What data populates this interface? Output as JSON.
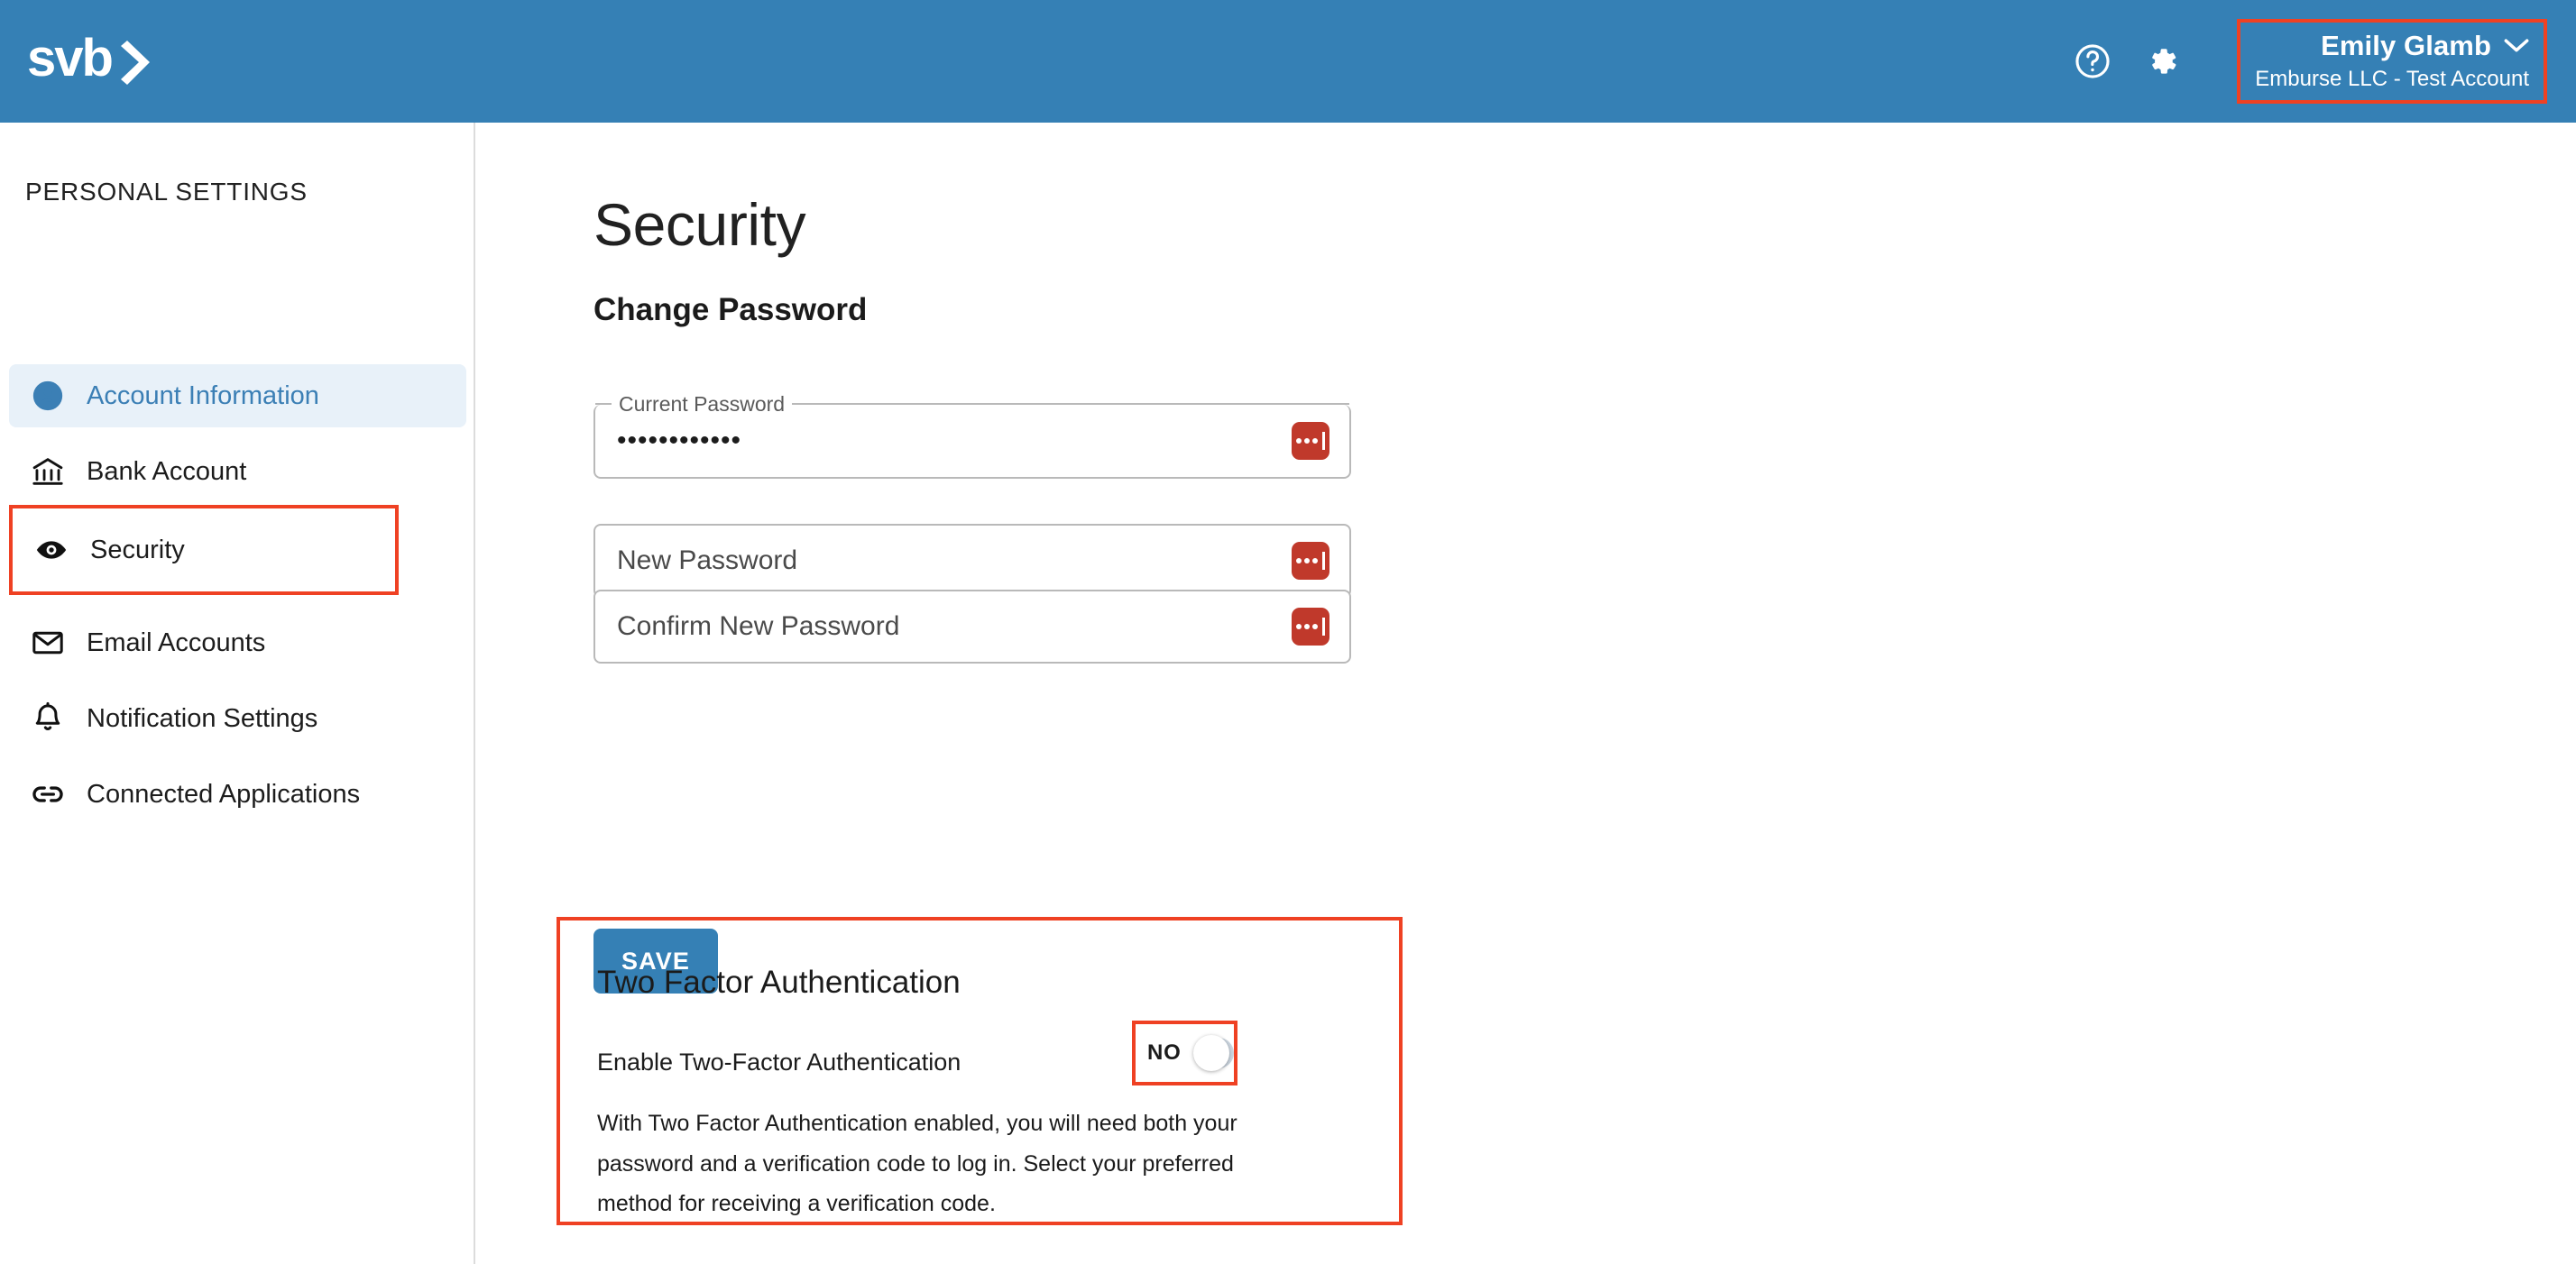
{
  "header": {
    "logo_text": "svb",
    "logo_icon": "svb-chevron-logo",
    "help_icon": "help-circle-icon",
    "settings_icon": "gear-icon",
    "user_name": "Emily Glamb",
    "user_org": "Emburse LLC - Test Account",
    "chevron_icon": "chevron-down-icon",
    "background_color": "#3580b5"
  },
  "sidebar": {
    "title": "PERSONAL SETTINGS",
    "items": [
      {
        "label": "Account Information",
        "icon": "user-circle-icon",
        "active": true,
        "highlighted": false
      },
      {
        "label": "Bank Account",
        "icon": "bank-icon",
        "active": false,
        "highlighted": false
      },
      {
        "label": "Security",
        "icon": "eye-icon",
        "active": false,
        "highlighted": true
      },
      {
        "label": "Email Accounts",
        "icon": "envelope-icon",
        "active": false,
        "highlighted": false
      },
      {
        "label": "Notification Settings",
        "icon": "bell-icon",
        "active": false,
        "highlighted": false
      },
      {
        "label": "Connected Applications",
        "icon": "link-icon",
        "active": false,
        "highlighted": false
      }
    ]
  },
  "main": {
    "page_title": "Security",
    "section_title": "Change Password",
    "fields": [
      {
        "legend": "Current Password",
        "value": "••••••••••••",
        "placeholder": "",
        "lastpass_icon": "lastpass-icon"
      },
      {
        "legend": "",
        "value": "",
        "placeholder": "New Password",
        "lastpass_icon": "lastpass-icon"
      },
      {
        "legend": "",
        "value": "",
        "placeholder": "Confirm New Password",
        "lastpass_icon": "lastpass-icon"
      }
    ],
    "save_label": "SAVE",
    "two_factor": {
      "title": "Two Factor Authentication",
      "row_label": "Enable Two-Factor Authentication",
      "toggle_value": "NO",
      "toggle_on": false,
      "description": "With Two Factor Authentication enabled, you will need both your password and a verification code to log in. Select your preferred method for receiving a verification code."
    }
  },
  "annotations": {
    "highlight_color": "#ef4123",
    "boxes": [
      "user-menu",
      "sidebar-security",
      "two-factor-section",
      "two-factor-toggle"
    ]
  },
  "colors": {
    "brand_blue": "#3580b5",
    "active_nav_bg": "#e8f1f9",
    "active_nav_text": "#3b7fb5",
    "lastpass_red": "#c0392b",
    "toggle_track": "#ccd6e0"
  }
}
